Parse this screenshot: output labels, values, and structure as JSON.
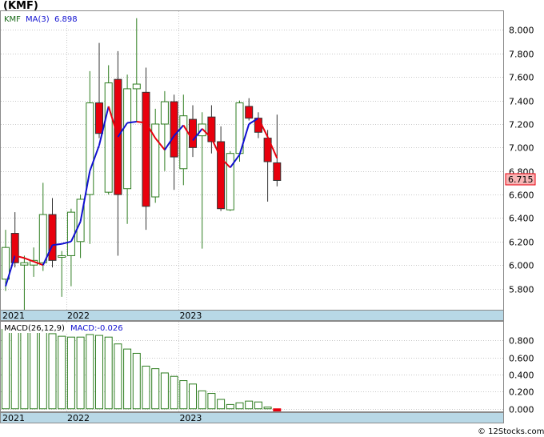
{
  "ticker_label": "(KMF)",
  "credit": "© 12Stocks.com",
  "chart_data": [
    {
      "type": "candlestick",
      "symbol": "KMF",
      "legend": {
        "symbol": "KMF",
        "ma_label": "MA(3)",
        "ma_value": "6.898"
      },
      "last_price_label": "6.715",
      "ylim": [
        5.62,
        8.16
      ],
      "y_ticks": [
        5.8,
        6.0,
        6.2,
        6.4,
        6.6,
        6.8,
        7.0,
        7.2,
        7.4,
        7.6,
        7.8,
        8.0
      ],
      "x_labels": [
        {
          "text": "2021",
          "index": 0
        },
        {
          "text": "2022",
          "index": 7
        },
        {
          "text": "2023",
          "index": 19
        }
      ],
      "colors": {
        "up": "#2e7d20",
        "down": "#e8000d",
        "ma_up": "#1010d0",
        "ma_down": "#e8000d"
      },
      "candles": [
        {
          "o": 5.88,
          "h": 6.3,
          "l": 5.78,
          "c": 6.15
        },
        {
          "o": 6.27,
          "h": 6.45,
          "l": 5.98,
          "c": 6.02
        },
        {
          "o": 6.0,
          "h": 6.08,
          "l": 5.62,
          "c": 6.02
        },
        {
          "o": 6.0,
          "h": 6.15,
          "l": 5.9,
          "c": 6.04
        },
        {
          "o": 6.02,
          "h": 6.7,
          "l": 5.95,
          "c": 6.43
        },
        {
          "o": 6.43,
          "h": 6.57,
          "l": 5.98,
          "c": 6.04
        },
        {
          "o": 6.07,
          "h": 6.12,
          "l": 5.73,
          "c": 6.08
        },
        {
          "o": 6.08,
          "h": 6.48,
          "l": 5.82,
          "c": 6.45
        },
        {
          "o": 6.2,
          "h": 6.6,
          "l": 6.06,
          "c": 6.56
        },
        {
          "o": 6.6,
          "h": 7.65,
          "l": 6.18,
          "c": 7.38
        },
        {
          "o": 7.38,
          "h": 7.89,
          "l": 7.08,
          "c": 7.12
        },
        {
          "o": 6.62,
          "h": 7.7,
          "l": 6.6,
          "c": 7.55
        },
        {
          "o": 7.58,
          "h": 7.82,
          "l": 6.08,
          "c": 6.6
        },
        {
          "o": 6.65,
          "h": 7.62,
          "l": 6.35,
          "c": 7.5
        },
        {
          "o": 7.5,
          "h": 8.1,
          "l": 7.22,
          "c": 7.54
        },
        {
          "o": 7.47,
          "h": 7.68,
          "l": 6.3,
          "c": 6.5
        },
        {
          "o": 6.58,
          "h": 7.33,
          "l": 6.53,
          "c": 7.2
        },
        {
          "o": 7.2,
          "h": 7.48,
          "l": 6.8,
          "c": 7.39
        },
        {
          "o": 7.39,
          "h": 7.45,
          "l": 6.64,
          "c": 6.92
        },
        {
          "o": 6.82,
          "h": 7.45,
          "l": 6.68,
          "c": 7.27
        },
        {
          "o": 7.24,
          "h": 7.36,
          "l": 6.92,
          "c": 7.0
        },
        {
          "o": 7.1,
          "h": 7.3,
          "l": 6.14,
          "c": 7.2
        },
        {
          "o": 7.26,
          "h": 7.36,
          "l": 6.95,
          "c": 7.05
        },
        {
          "o": 7.05,
          "h": 7.18,
          "l": 6.46,
          "c": 6.48
        },
        {
          "o": 6.47,
          "h": 6.97,
          "l": 6.46,
          "c": 6.95
        },
        {
          "o": 6.95,
          "h": 7.4,
          "l": 6.88,
          "c": 7.38
        },
        {
          "o": 7.35,
          "h": 7.42,
          "l": 7.23,
          "c": 7.25
        },
        {
          "o": 7.25,
          "h": 7.3,
          "l": 7.08,
          "c": 7.13
        },
        {
          "o": 7.08,
          "h": 7.15,
          "l": 6.54,
          "c": 6.88
        },
        {
          "o": 6.87,
          "h": 7.28,
          "l": 6.67,
          "c": 6.72
        }
      ],
      "ma3": [
        5.82,
        6.08,
        6.06,
        6.03,
        6.0,
        6.17,
        6.18,
        6.2,
        6.37,
        6.8,
        7.02,
        7.35,
        7.09,
        7.21,
        7.22,
        7.21,
        7.08,
        6.98,
        7.1,
        7.19,
        7.06,
        7.16,
        7.08,
        6.91,
        6.83,
        6.94,
        7.2,
        7.25,
        7.09,
        6.91
      ]
    },
    {
      "type": "bar",
      "indicator": "MACD",
      "legend": {
        "label": "MACD(26,12,9)",
        "value_label": "MACD:-0.026"
      },
      "ylim": [
        -0.04,
        1.02
      ],
      "y_ticks": [
        0.0,
        0.2,
        0.4,
        0.6,
        0.8
      ],
      "x_labels": [
        {
          "text": "2021",
          "index": 0
        },
        {
          "text": "2022",
          "index": 7
        },
        {
          "text": "2023",
          "index": 19
        }
      ],
      "colors": {
        "positive": "#2e7d20",
        "negative": "#e8000d"
      },
      "values": [
        0.93,
        0.95,
        0.96,
        0.96,
        0.94,
        0.88,
        0.85,
        0.84,
        0.84,
        0.87,
        0.86,
        0.84,
        0.76,
        0.7,
        0.65,
        0.5,
        0.47,
        0.42,
        0.38,
        0.33,
        0.29,
        0.21,
        0.18,
        0.11,
        0.05,
        0.07,
        0.09,
        0.08,
        0.02,
        -0.026
      ]
    }
  ]
}
